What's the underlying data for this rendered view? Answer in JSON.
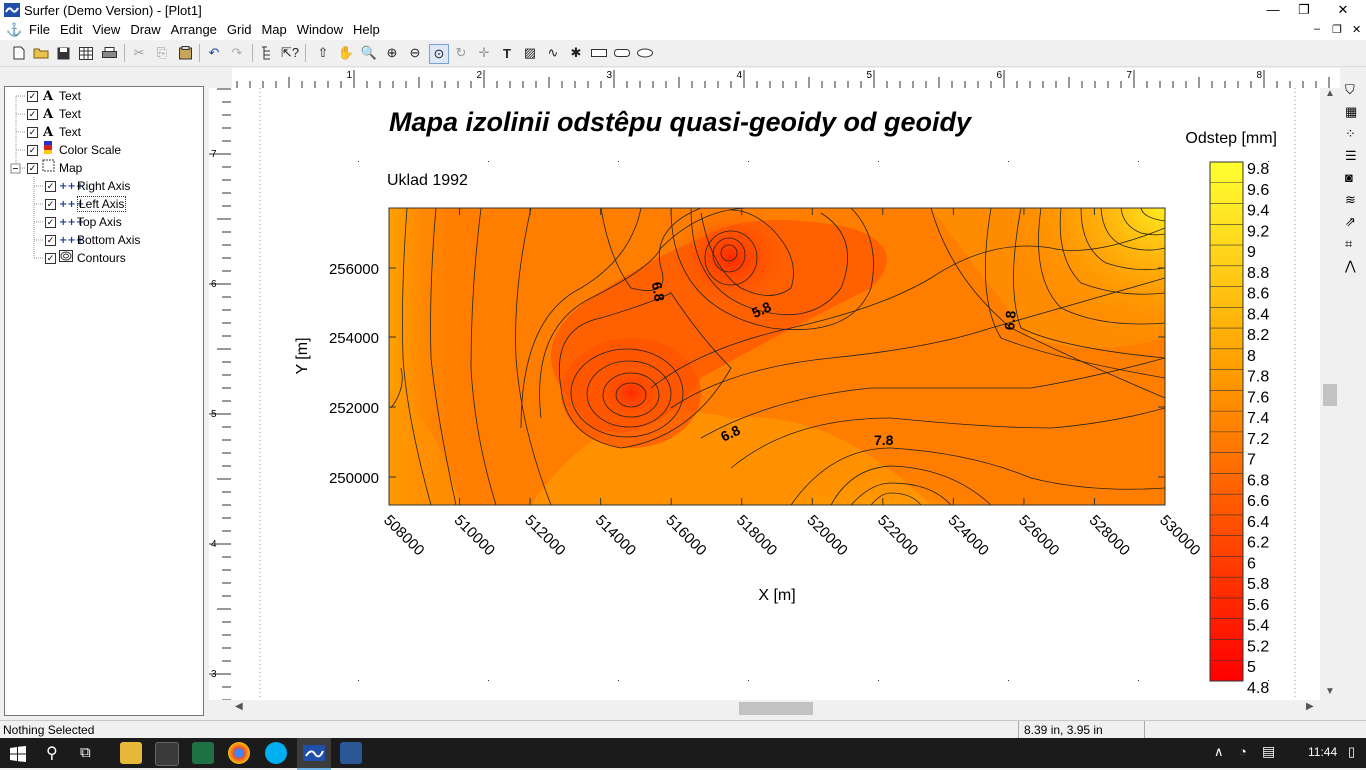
{
  "window": {
    "title": "Surfer (Demo Version) - [Plot1]",
    "minimize": "—",
    "restore": "❐",
    "close": "✕",
    "child_minimize": "–",
    "child_restore": "❐",
    "child_close": "✕"
  },
  "menu": [
    "File",
    "Edit",
    "View",
    "Draw",
    "Arrange",
    "Grid",
    "Map",
    "Window",
    "Help"
  ],
  "tree": {
    "items": [
      {
        "label": "Text",
        "icon": "text-icon"
      },
      {
        "label": "Text",
        "icon": "text-icon"
      },
      {
        "label": "Text",
        "icon": "text-icon"
      },
      {
        "label": "Color Scale",
        "icon": "color-scale-icon"
      },
      {
        "label": "Map",
        "icon": "map-frame-icon",
        "expanded": true
      },
      {
        "label": "Right Axis",
        "icon": "axis-icon"
      },
      {
        "label": "Left Axis",
        "icon": "axis-icon",
        "selected": true
      },
      {
        "label": "Top Axis",
        "icon": "axis-icon"
      },
      {
        "label": "Bottom Axis",
        "icon": "axis-icon"
      },
      {
        "label": "Contours",
        "icon": "contours-icon"
      }
    ]
  },
  "rulers": {
    "horizontal": [
      "1",
      "2",
      "3",
      "4",
      "5",
      "6",
      "7",
      "8"
    ],
    "vertical": [
      "7",
      "6",
      "5",
      "4",
      "3"
    ]
  },
  "plot": {
    "title": "Mapa izolinii odstêpu quasi-geoidy od geoidy",
    "subtitle": "Uklad 1992",
    "xlabel": "X [m]",
    "ylabel": "Y [m]",
    "x_ticks": [
      "508000",
      "510000",
      "512000",
      "514000",
      "516000",
      "518000",
      "520000",
      "522000",
      "524000",
      "526000",
      "528000",
      "530000"
    ],
    "y_ticks": [
      "256000",
      "254000",
      "252000",
      "250000"
    ],
    "contour_labels": [
      "6.8",
      "5.8",
      "6.8",
      "6.8",
      "7.8"
    ],
    "legend_title": "Odstep [mm]",
    "legend_levels": [
      "9.8",
      "9.6",
      "9.4",
      "9.2",
      "9",
      "8.8",
      "8.6",
      "8.4",
      "8.2",
      "8",
      "7.8",
      "7.6",
      "7.4",
      "7.2",
      "7",
      "6.8",
      "6.6",
      "6.4",
      "6.2",
      "6",
      "5.8",
      "5.6",
      "5.4",
      "5.2",
      "5",
      "4.8"
    ],
    "colors": {
      "low": "#ff0000",
      "mid": "#ff8000",
      "high": "#ffff00"
    }
  },
  "status": {
    "selection": "Nothing Selected",
    "coords": "8.39 in, 3.95 in"
  },
  "taskbar": {
    "clock": "11:44"
  }
}
